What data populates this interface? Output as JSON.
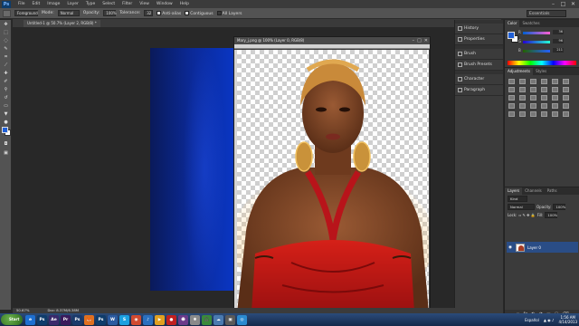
{
  "app": {
    "logo": "Ps"
  },
  "menu": [
    "File",
    "Edit",
    "Image",
    "Layer",
    "Type",
    "Select",
    "Filter",
    "View",
    "Window",
    "Help"
  ],
  "window_controls": [
    "–",
    "□",
    "✕"
  ],
  "options": {
    "tool_preset": "Foreground",
    "mode_label": "Mode:",
    "mode_value": "Normal",
    "opacity_label": "Opacity:",
    "opacity_value": "100%",
    "tolerance_label": "Tolerance:",
    "tolerance_value": "32",
    "anti_alias": "Anti-alias",
    "contiguous": "Contiguous",
    "all_layers": "All Layers",
    "workspace": "Essentials"
  },
  "docs": {
    "back_tab": "Untitled-1 @ 50.7% (Layer 2, RGB/8) *",
    "front_title": "Mary_j.png @ 100% (Layer 0, RGB/8)"
  },
  "dock": {
    "items": [
      {
        "label": "History",
        "icon": "history-icon"
      },
      {
        "label": "Properties",
        "icon": "properties-icon"
      },
      {
        "label": "Brush",
        "icon": "brush-icon"
      },
      {
        "label": "Brush Presets",
        "icon": "brush-presets-icon"
      },
      {
        "label": "Character",
        "icon": "character-icon"
      },
      {
        "label": "Paragraph",
        "icon": "paragraph-icon"
      }
    ]
  },
  "color_panel": {
    "tabs": [
      "Color",
      "Swatches"
    ],
    "r_label": "R",
    "r_value": "36",
    "g_label": "G",
    "g_value": "96",
    "b_label": "B",
    "b_value": "211",
    "fg_color": "#1f5fd6"
  },
  "adjustments": {
    "tabs": [
      "Adjustments",
      "Styles"
    ]
  },
  "layers": {
    "tabs": [
      "Layers",
      "Channels",
      "Paths"
    ],
    "kind_label": "Kind",
    "blend": "Normal",
    "opacity_label": "Opacity:",
    "opacity_value": "100%",
    "lock_label": "Lock:",
    "fill_label": "Fill:",
    "fill_value": "100%",
    "layer_name": "Layer 0"
  },
  "status": {
    "zoom": "50.67%",
    "doc": "Doc: 8.37M/6.38M"
  },
  "taskbar": {
    "start": "Start",
    "apps": [
      "e",
      "Ps",
      "Ae",
      "Pr",
      "Ps",
      "🦊",
      "Ps",
      "W",
      "S",
      "◉",
      "♪",
      "▶",
      "●",
      "☻",
      "✱",
      "🎧",
      "☁",
      "▣",
      "◎"
    ],
    "lang": "Español",
    "time": "1:56 AM",
    "date": "4/14/2013"
  }
}
